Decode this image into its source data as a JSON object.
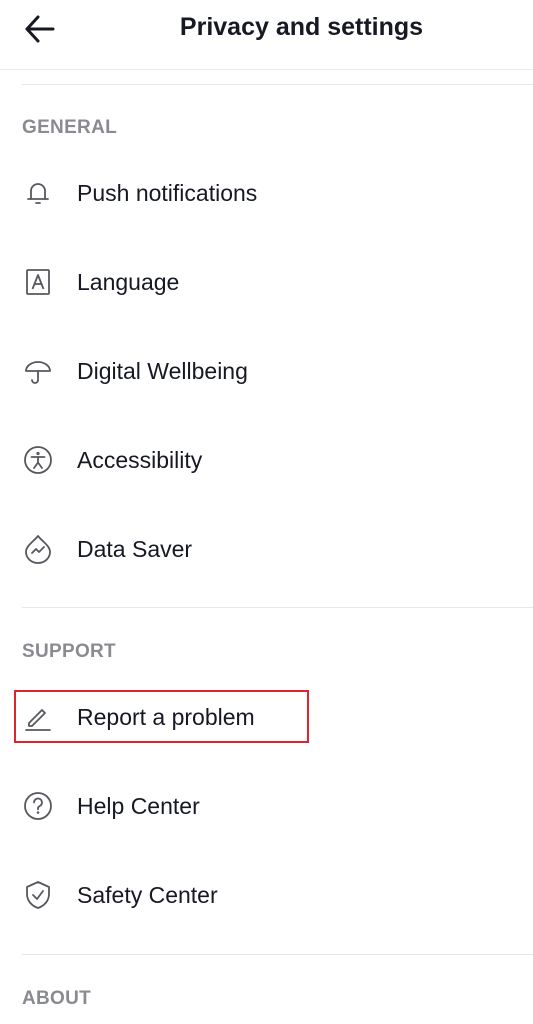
{
  "header": {
    "title": "Privacy and settings",
    "back_icon": "arrow-left-icon"
  },
  "sections": {
    "general": {
      "header": "GENERAL",
      "items": [
        {
          "label": "Push notifications",
          "icon": "bell-icon"
        },
        {
          "label": "Language",
          "icon": "language-icon"
        },
        {
          "label": "Digital Wellbeing",
          "icon": "umbrella-icon"
        },
        {
          "label": "Accessibility",
          "icon": "accessibility-icon"
        },
        {
          "label": "Data Saver",
          "icon": "data-saver-icon"
        }
      ]
    },
    "support": {
      "header": "SUPPORT",
      "items": [
        {
          "label": "Report a problem",
          "icon": "pencil-icon"
        },
        {
          "label": "Help Center",
          "icon": "help-icon"
        },
        {
          "label": "Safety Center",
          "icon": "shield-check-icon"
        }
      ]
    },
    "about": {
      "header": "ABOUT"
    }
  },
  "colors": {
    "text": "#161823",
    "section_header": "#8a8b91",
    "icon": "#57585f",
    "divider": "#e6e6e6",
    "highlight": "#e0242d"
  }
}
